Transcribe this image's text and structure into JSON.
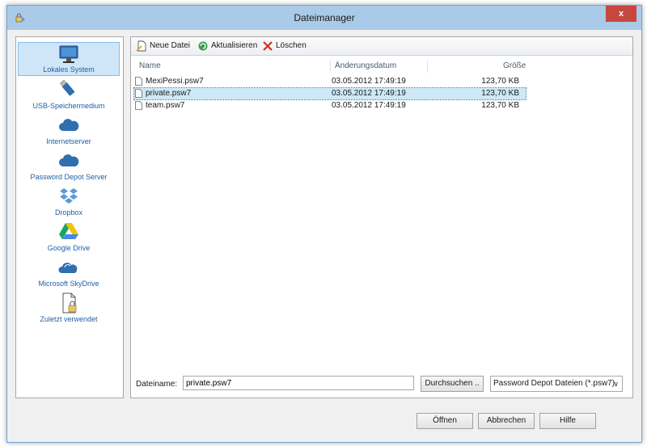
{
  "window": {
    "title": "Dateimanager",
    "close_label": "x"
  },
  "sidebar": {
    "items": [
      {
        "label": "Lokales System",
        "icon": "monitor-icon"
      },
      {
        "label": "USB-Speichermedium",
        "icon": "usb-stick-icon"
      },
      {
        "label": "Internetserver",
        "icon": "cloud-icon"
      },
      {
        "label": "Password Depot Server",
        "icon": "cloud-icon"
      },
      {
        "label": "Dropbox",
        "icon": "dropbox-icon"
      },
      {
        "label": "Google Drive",
        "icon": "google-drive-icon"
      },
      {
        "label": "Microsoft SkyDrive",
        "icon": "skydrive-icon"
      },
      {
        "label": "Zuletzt verwendet",
        "icon": "recent-file-icon"
      }
    ]
  },
  "toolbar": {
    "new_file": "Neue Datei",
    "refresh": "Aktualisieren",
    "delete": "Löschen"
  },
  "table": {
    "columns": {
      "name": "Name",
      "date": "Änderungsdatum",
      "size": "Größe"
    },
    "rows": [
      {
        "name": "MexiPessi.psw7",
        "date": "03.05.2012 17:49:19",
        "size": "123,70 KB"
      },
      {
        "name": "private.psw7",
        "date": "03.05.2012 17:49:19",
        "size": "123,70 KB"
      },
      {
        "name": "team.psw7",
        "date": "03.05.2012 17:49:19",
        "size": "123,70 KB"
      }
    ],
    "selected_row": 1
  },
  "filename": {
    "label": "Dateiname:",
    "value": "private.psw7"
  },
  "browse_label": "Durchsuchen ..",
  "filter": {
    "selected": "Password Depot Dateien (*.psw7)"
  },
  "buttons": {
    "open": "Öffnen",
    "cancel": "Abbrechen",
    "help": "Hilfe"
  },
  "colors": {
    "accent": "#1f5fa8",
    "selection": "#cde8f7",
    "titlebar": "#a9cae8",
    "close": "#c7473f"
  }
}
